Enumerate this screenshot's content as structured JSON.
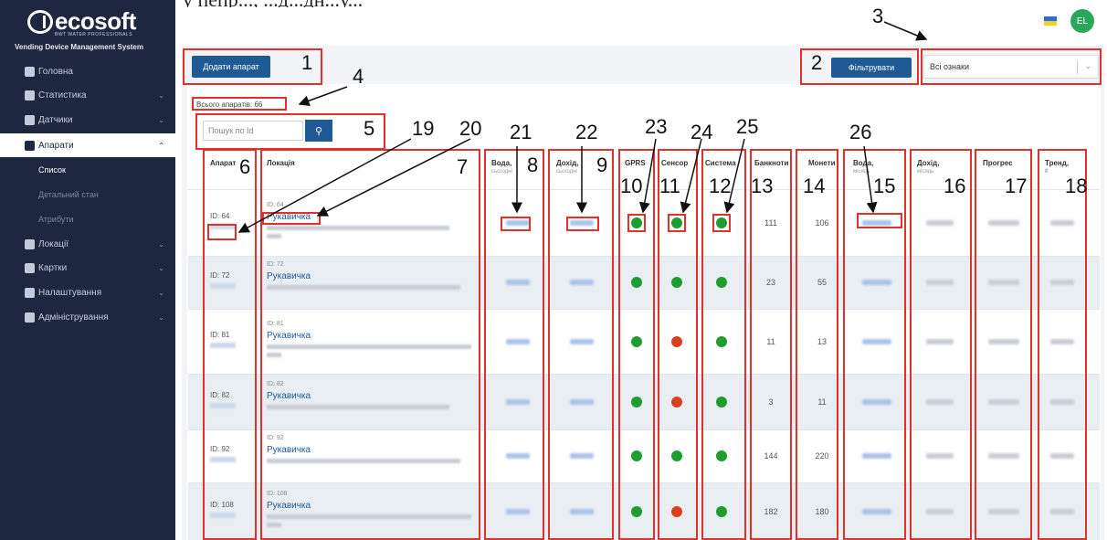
{
  "caption_fragment": "у пепр..., ...д...дн...у...",
  "brand": {
    "name": "ecosoft",
    "sub": "BWT WATER PROFESSIONALS",
    "tagline": "Vending Device Management System"
  },
  "sidebar": {
    "items": [
      {
        "label": "Головна",
        "icon": "home-icon"
      },
      {
        "label": "Статистика",
        "icon": "stats-icon"
      },
      {
        "label": "Датчики",
        "icon": "sensor-icon"
      },
      {
        "label": "Апарати",
        "icon": "machine-icon"
      },
      {
        "label": "Локації",
        "icon": "location-icon"
      },
      {
        "label": "Картки",
        "icon": "card-icon"
      },
      {
        "label": "Налаштування",
        "icon": "gear-icon"
      },
      {
        "label": "Адміністрування",
        "icon": "users-icon"
      }
    ],
    "subitems": [
      "Список",
      "Детальний стан",
      "Атрибути"
    ]
  },
  "header": {
    "avatar": "EL"
  },
  "toolbar": {
    "add_label": "Додати апарат",
    "filter_label": "Фільтрувати",
    "select_value": "Всі ознаки",
    "count": "Всього апаратів: 66",
    "search_placeholder": "Пошук по Id"
  },
  "table": {
    "headers": [
      {
        "t": "Апарат",
        "s": ""
      },
      {
        "t": "Локація",
        "s": ""
      },
      {
        "t": "Вода,",
        "s": "сьогодні"
      },
      {
        "t": "Дохід,",
        "s": "сьогодні"
      },
      {
        "t": "GPRS",
        "s": ""
      },
      {
        "t": "Сенсор",
        "s": ""
      },
      {
        "t": "Система",
        "s": ""
      },
      {
        "t": "Банкноти",
        "s": ""
      },
      {
        "t": "Монети",
        "s": ""
      },
      {
        "t": "Вода,",
        "s": "місяць"
      },
      {
        "t": "Дохід,",
        "s": "місяць"
      },
      {
        "t": "Прогрес",
        "s": ""
      },
      {
        "t": "Тренд,",
        "s": "₴"
      }
    ],
    "rows": [
      {
        "id": "ID: 64",
        "loc_id": "ID: 64",
        "loc": "Рукавичка",
        "sensor": "green",
        "bills": "111",
        "coins": "106"
      },
      {
        "id": "ID: 72",
        "loc_id": "ID: 72",
        "loc": "Рукавичка",
        "sensor": "green",
        "bills": "23",
        "coins": "55"
      },
      {
        "id": "ID: 81",
        "loc_id": "ID: 81",
        "loc": "Рукавичка",
        "sensor": "red",
        "bills": "11",
        "coins": "13"
      },
      {
        "id": "ID: 82",
        "loc_id": "ID: 82",
        "loc": "Рукавичка",
        "sensor": "red",
        "bills": "3",
        "coins": "11"
      },
      {
        "id": "ID: 92",
        "loc_id": "ID: 92",
        "loc": "Рукавичка",
        "sensor": "green",
        "bills": "144",
        "coins": "220"
      },
      {
        "id": "ID: 108",
        "loc_id": "ID: 108",
        "loc": "Рукавичка",
        "sensor": "red",
        "bills": "182",
        "coins": "180"
      }
    ]
  },
  "annotations": [
    "1",
    "2",
    "3",
    "4",
    "5",
    "6",
    "7",
    "8",
    "9",
    "10",
    "11",
    "12",
    "13",
    "14",
    "15",
    "16",
    "17",
    "18",
    "19",
    "20",
    "21",
    "22",
    "23",
    "24",
    "25",
    "26"
  ],
  "colors": {
    "sidebar": "#1e2740",
    "primary": "#1f5a96",
    "annotation": "#e0312d",
    "ok": "#1e9e2e",
    "fail": "#d9411e"
  }
}
